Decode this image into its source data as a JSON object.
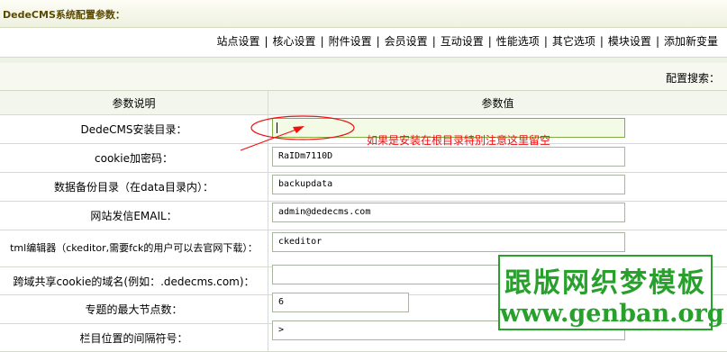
{
  "title": "DedeCMS系统配置参数：",
  "nav": {
    "items": [
      "站点设置",
      "核心设置",
      "附件设置",
      "会员设置",
      "互动设置",
      "性能选项",
      "其它选项",
      "模块设置",
      "添加新变量"
    ],
    "separator": "|"
  },
  "search": {
    "label": "配置搜索："
  },
  "table": {
    "headers": {
      "name": "参数说明",
      "value": "参数值"
    },
    "rows": [
      {
        "label": "DedeCMS安装目录：",
        "value": ""
      },
      {
        "label": "cookie加密码：",
        "value": "RaIDm7110D"
      },
      {
        "label": "数据备份目录（在data目录内）：",
        "value": "backupdata"
      },
      {
        "label": "网站发信EMAIL：",
        "value": "admin@dedecms.com"
      },
      {
        "label": "tml编辑器（ckeditor,需要fck的用户可以去官网下载）：",
        "value": "ckeditor"
      },
      {
        "label": "跨域共享cookie的域名(例如：.dedecms.com)：",
        "value": ""
      },
      {
        "label": "专题的最大节点数：",
        "value": "6"
      },
      {
        "label": "栏目位置的间隔符号：",
        "value": ">"
      }
    ]
  },
  "annotation": {
    "note": "如果是安装在根目录特别注意这里留空",
    "color": "#ee1111"
  },
  "watermark": {
    "cn": "跟版网织梦模板",
    "en": "www.genban.org",
    "color": "#27a02c"
  }
}
